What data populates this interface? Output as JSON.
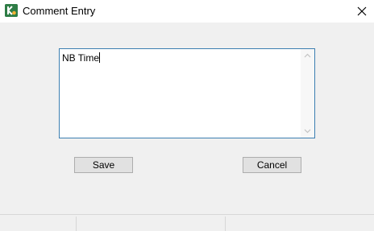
{
  "window": {
    "title": "Comment Entry",
    "app_icon": "app-logo-icon",
    "close_icon": "close-icon"
  },
  "comment": {
    "value": "NB Time"
  },
  "buttons": {
    "save_label": "Save",
    "cancel_label": "Cancel"
  },
  "colors": {
    "accent_border": "#3c7fb1",
    "dialog_bg": "#f0f0f0",
    "app_icon_green": "#2e7d46"
  }
}
